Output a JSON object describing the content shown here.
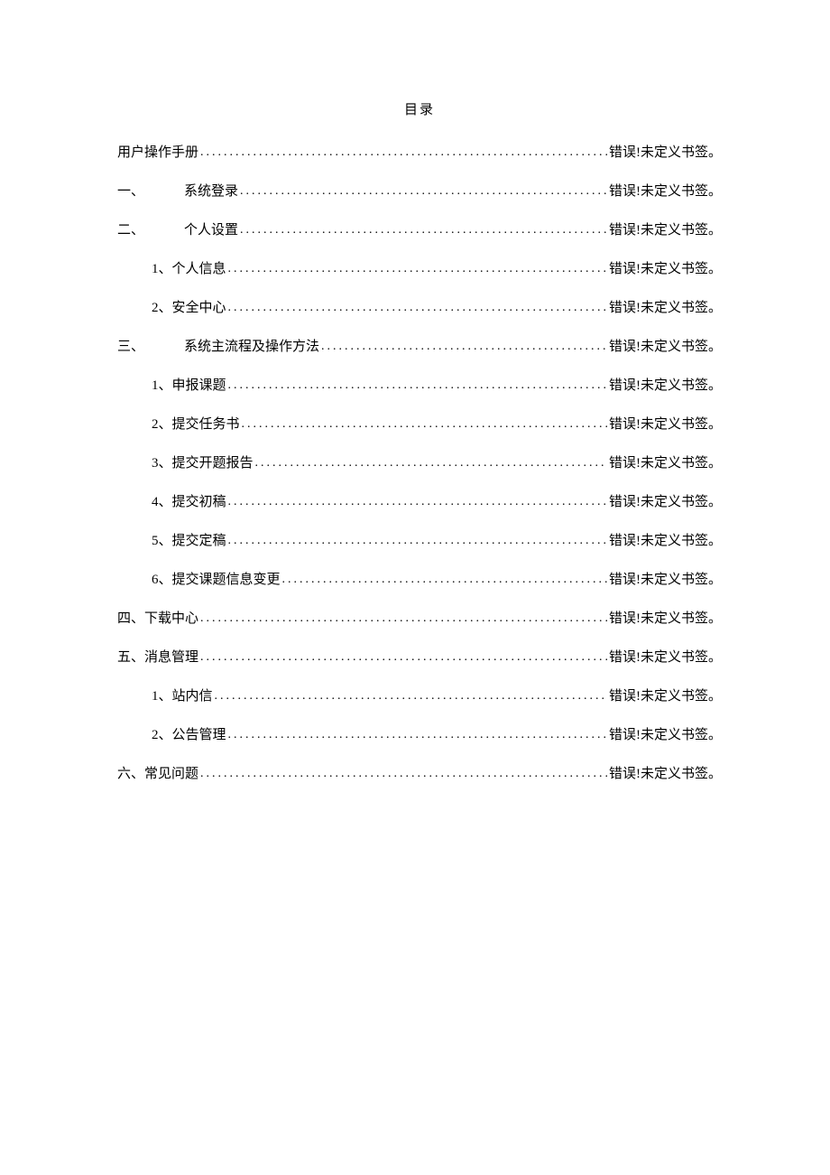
{
  "title": "目录",
  "errorText": "错误!未定义书签。",
  "entries": [
    {
      "level": 0,
      "label": "用户操作手册",
      "gap": false
    },
    {
      "level": 0,
      "num": "一、",
      "label": "系统登录",
      "gap": true
    },
    {
      "level": 0,
      "num": "二、",
      "label": "个人设置",
      "gap": true
    },
    {
      "level": 1,
      "label": "1、个人信息"
    },
    {
      "level": 1,
      "label": "2、安全中心"
    },
    {
      "level": 0,
      "num": "三、",
      "label": "系统主流程及操作方法",
      "gap": true
    },
    {
      "level": 1,
      "label": "1、申报课题"
    },
    {
      "level": 1,
      "label": "2、提交任务书"
    },
    {
      "level": 1,
      "label": "3、提交开题报告"
    },
    {
      "level": 1,
      "label": "4、提交初稿"
    },
    {
      "level": 1,
      "label": "5、提交定稿"
    },
    {
      "level": 1,
      "label": "6、提交课题信息变更"
    },
    {
      "level": 0,
      "label": "四、下载中心"
    },
    {
      "level": 0,
      "label": "五、消息管理"
    },
    {
      "level": 1,
      "label": "1、站内信"
    },
    {
      "level": 1,
      "label": "2、公告管理"
    },
    {
      "level": 0,
      "label": "六、常见问题"
    }
  ]
}
